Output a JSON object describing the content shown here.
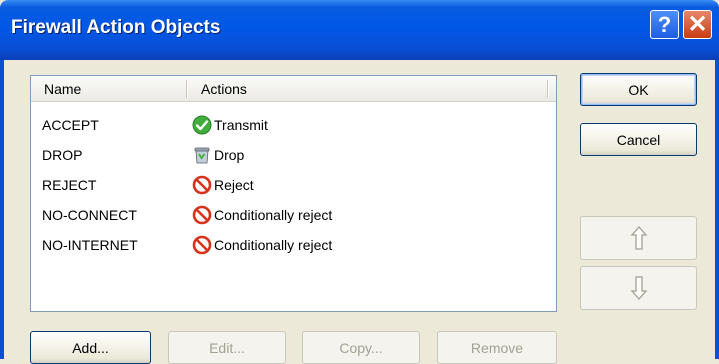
{
  "window": {
    "title": "Firewall Action Objects",
    "help_glyph": "?",
    "close_glyph": "✕"
  },
  "list": {
    "columns": [
      "Name",
      "Actions"
    ],
    "rows": [
      {
        "name": "ACCEPT",
        "action": "Transmit",
        "icon": "check-icon"
      },
      {
        "name": "DROP",
        "action": "Drop",
        "icon": "trash-icon"
      },
      {
        "name": "REJECT",
        "action": "Reject",
        "icon": "prohibited-icon"
      },
      {
        "name": "NO-CONNECT",
        "action": "Conditionally reject",
        "icon": "prohibited-icon"
      },
      {
        "name": "NO-INTERNET",
        "action": "Conditionally reject",
        "icon": "prohibited-icon"
      }
    ]
  },
  "buttons": {
    "ok": "OK",
    "cancel": "Cancel",
    "add": "Add...",
    "edit": "Edit...",
    "copy": "Copy...",
    "remove": "Remove"
  },
  "colors": {
    "titlebar": "#0058e6",
    "dialog_bg": "#ece9d8",
    "accept": "#3fae3a",
    "reject": "#d9321c"
  }
}
